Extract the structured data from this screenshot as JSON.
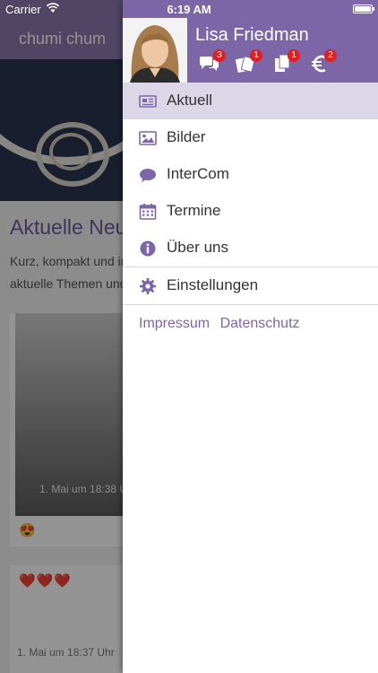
{
  "status_bar": {
    "carrier": "Carrier",
    "time": "6:19 AM"
  },
  "background_page": {
    "nav_title": "chumi chum",
    "heading": "Aktuelle Neu",
    "intro_lines": [
      "Kurz, kompakt und in",
      "aktuelle Themen und"
    ],
    "posts": [
      {
        "date": "1. Mai um 18:38 U",
        "reaction": "😍"
      },
      {
        "hearts": "❤️❤️❤️",
        "date": "1. Mai um 18:37 Uhr"
      }
    ]
  },
  "drawer": {
    "user_name": "Lisa Friedman",
    "profile_icons": [
      {
        "icon": "chat-bubbles-icon",
        "badge": "3"
      },
      {
        "icon": "cards-icon",
        "badge": "1"
      },
      {
        "icon": "documents-icon",
        "badge": "1"
      },
      {
        "icon": "euro-icon",
        "badge": "2"
      }
    ],
    "menu": [
      {
        "label": "Aktuell",
        "icon": "newspaper-icon",
        "active": true
      },
      {
        "label": "Bilder",
        "icon": "image-icon"
      },
      {
        "label": "InterCom",
        "icon": "speech-bubble-icon"
      },
      {
        "label": "Termine",
        "icon": "calendar-icon"
      },
      {
        "label": "Über uns",
        "icon": "info-icon"
      },
      {
        "label": "Einstellungen",
        "icon": "gear-icon"
      }
    ],
    "footer_links": [
      "Impressum",
      "Datenschutz"
    ]
  },
  "colors": {
    "brand_purple": "#7c66a8",
    "active_row": "#dcd7e7",
    "badge_red": "#e02020"
  }
}
